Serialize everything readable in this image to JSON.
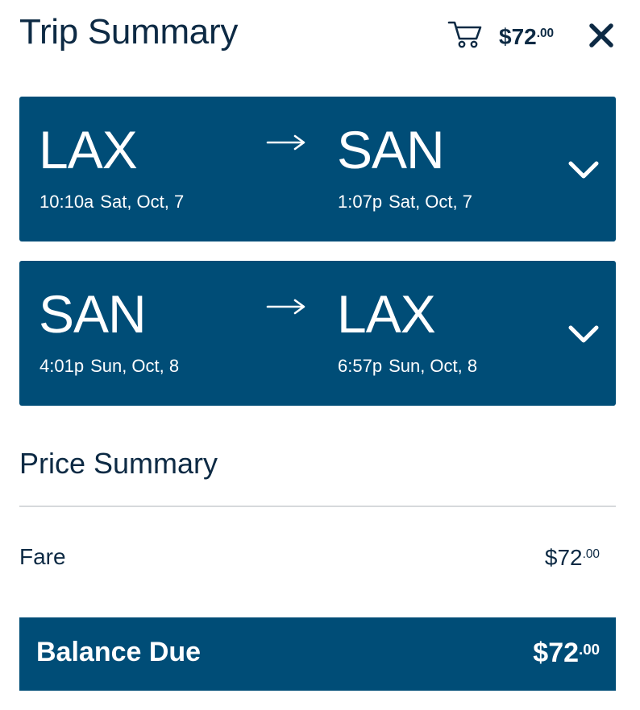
{
  "header": {
    "title": "Trip Summary",
    "cart_total_main": "$72",
    "cart_total_cents": ".00",
    "icons": {
      "cart": "cart-icon",
      "close": "close-icon"
    }
  },
  "flights": [
    {
      "origin_code": "LAX",
      "origin_time": "10:10a",
      "origin_date": "Sat, Oct, 7",
      "dest_code": "SAN",
      "dest_time": "1:07p",
      "dest_date": "Sat, Oct, 7"
    },
    {
      "origin_code": "SAN",
      "origin_time": "4:01p",
      "origin_date": "Sun, Oct, 8",
      "dest_code": "LAX",
      "dest_time": "6:57p",
      "dest_date": "Sun, Oct, 8"
    }
  ],
  "price_summary": {
    "title": "Price Summary",
    "fare_label": "Fare",
    "fare_main": "$72",
    "fare_cents": ".00",
    "balance_label": "Balance Due",
    "balance_main": "$72",
    "balance_cents": ".00"
  },
  "colors": {
    "brand_blue": "#004d77",
    "text_navy": "#0d2a44",
    "divider": "#d6d9dc"
  }
}
